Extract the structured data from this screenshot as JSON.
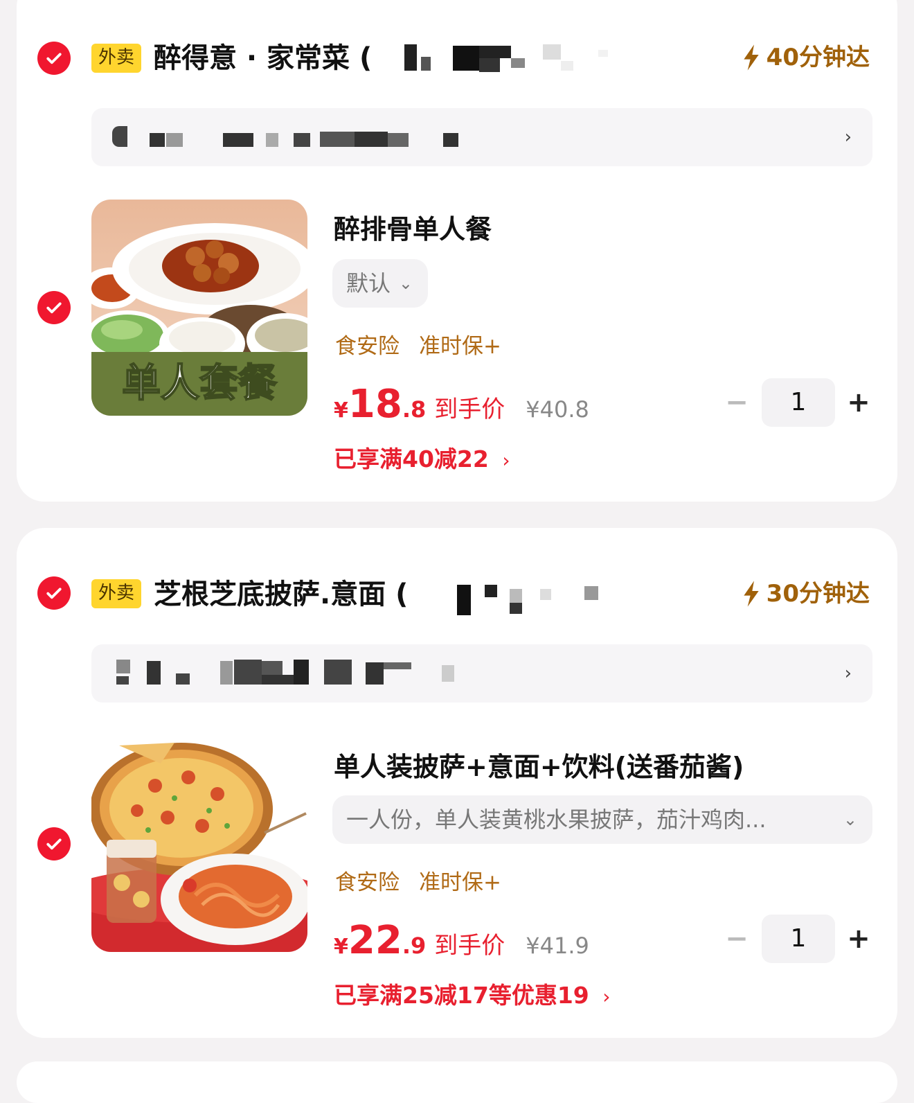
{
  "stores": [
    {
      "tag": "外卖",
      "name": "醉得意 · 家常菜 (",
      "eta": "40分钟达",
      "item": {
        "title": "醉排骨单人餐",
        "thumb_caption": "单人套餐",
        "spec": "默认",
        "insurance": [
          "食安险",
          "准时保+"
        ],
        "price_yen": "¥",
        "price_int": "18",
        "price_dec": ".8",
        "price_label": "到手价",
        "original_price": "¥40.8",
        "discount": "已享满40减22",
        "quantity": "1"
      }
    },
    {
      "tag": "外卖",
      "name": "芝根芝底披萨.意面 (",
      "eta": "30分钟达",
      "item": {
        "title": "单人装披萨+意面+饮料(送番茄酱)",
        "spec": "一人份，单人装黄桃水果披萨，茄汁鸡肉...",
        "insurance": [
          "食安险",
          "准时保+"
        ],
        "price_yen": "¥",
        "price_int": "22",
        "price_dec": ".9",
        "price_label": "到手价",
        "original_price": "¥41.9",
        "discount": "已享满25减17等优惠19",
        "quantity": "1"
      }
    }
  ],
  "colors": {
    "accent_red": "#e8202f",
    "check_red": "#f0172f",
    "tag_yellow": "#ffd52e",
    "eta_brown": "#a0610a",
    "insurance_brown": "#b06a16"
  },
  "icons": {
    "check": "check-icon",
    "lightning": "lightning-icon",
    "chevron_right": "chevron-right-icon",
    "chevron_down": "chevron-down-icon",
    "minus": "minus-icon",
    "plus": "plus-icon"
  }
}
